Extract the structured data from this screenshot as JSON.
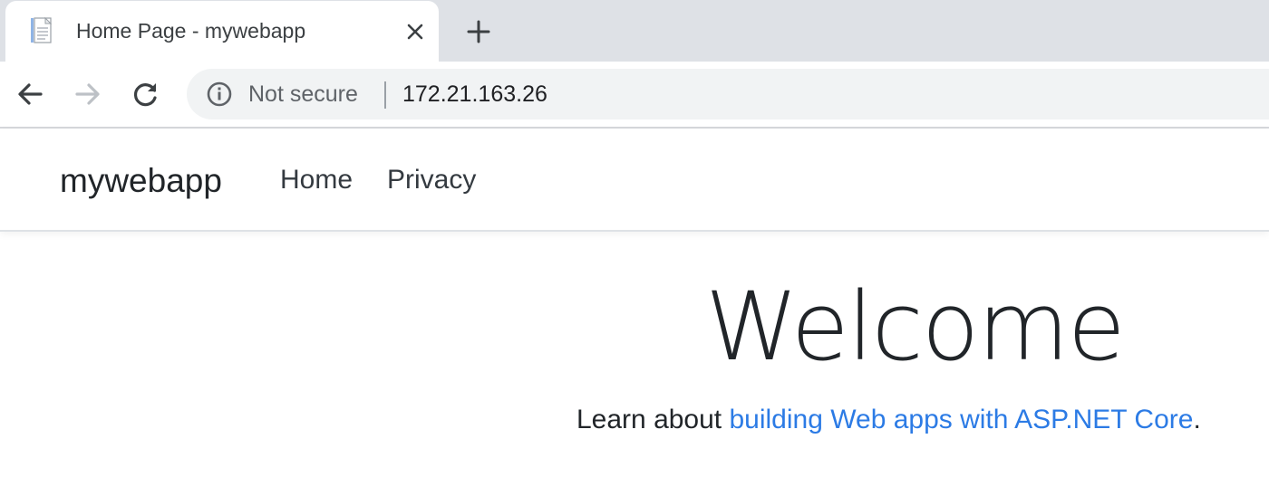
{
  "browser": {
    "tab": {
      "title": "Home Page - mywebapp",
      "favicon": "document-icon"
    },
    "new_tab_icon": "plus-icon",
    "address_bar": {
      "security_label": "Not secure",
      "url": "172.21.163.26"
    }
  },
  "page": {
    "navbar": {
      "brand": "mywebapp",
      "links": [
        "Home",
        "Privacy"
      ]
    },
    "main": {
      "heading": "Welcome",
      "intro_prefix": "Learn about ",
      "intro_link": "building Web apps with ASP.NET Core",
      "intro_suffix": "."
    }
  },
  "colors": {
    "tabstrip_bg": "#dee1e6",
    "omnibox_bg": "#f1f3f4",
    "link": "#2c7be5",
    "text": "#212529"
  }
}
